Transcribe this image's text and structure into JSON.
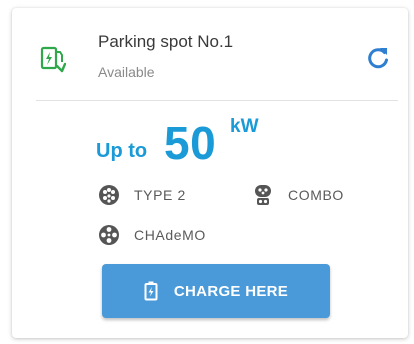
{
  "spot": {
    "title": "Parking spot No.1",
    "status": "Available",
    "icon": "ev-charger-icon",
    "refresh_icon": "refresh-icon"
  },
  "power": {
    "prefix": "Up to",
    "value": "50",
    "unit": "kW"
  },
  "connectors": [
    {
      "label": "TYPE 2",
      "icon": "type2-connector-icon"
    },
    {
      "label": "COMBO",
      "icon": "combo-connector-icon"
    },
    {
      "label": "CHAdeMO",
      "icon": "chademo-connector-icon"
    }
  ],
  "action": {
    "label": "CHARGE HERE",
    "icon": "battery-charge-icon"
  },
  "colors": {
    "accent_blue": "#1a9ad6",
    "button_blue": "#4a99d8",
    "available_green": "#2ea84a",
    "refresh_blue": "#2f7fd1"
  }
}
